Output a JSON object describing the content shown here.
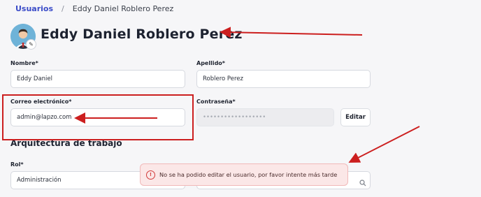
{
  "breadcrumb": {
    "parent": "Usuarios",
    "separator": "/",
    "current": "Eddy Daniel Roblero Perez"
  },
  "profile": {
    "name": "Eddy Daniel Roblero Perez",
    "avatar_icon": "user-avatar-icon",
    "edit_icon": "pencil-icon"
  },
  "form": {
    "nombre": {
      "label": "Nombre*",
      "value": "Eddy Daniel"
    },
    "apellido": {
      "label": "Apellido*",
      "value": "Roblero Perez"
    },
    "correo": {
      "label": "Correo electrónico*",
      "value": "admin@lapzo.com"
    },
    "contrasena": {
      "label": "Contraseña*",
      "value": "••••••••••••••••••"
    },
    "edit_button": "Editar"
  },
  "section": {
    "title": "Arquitectura de trabajo"
  },
  "rol": {
    "label": "Rol*",
    "value": "Administración"
  },
  "toast": {
    "message": "No se ha podido editar el usuario, por favor intente más tarde",
    "icon": "error-icon"
  },
  "colors": {
    "accent": "#3b4cc8",
    "annotation_red": "#cc1f1f",
    "toast_bg": "#fbe7e7"
  }
}
